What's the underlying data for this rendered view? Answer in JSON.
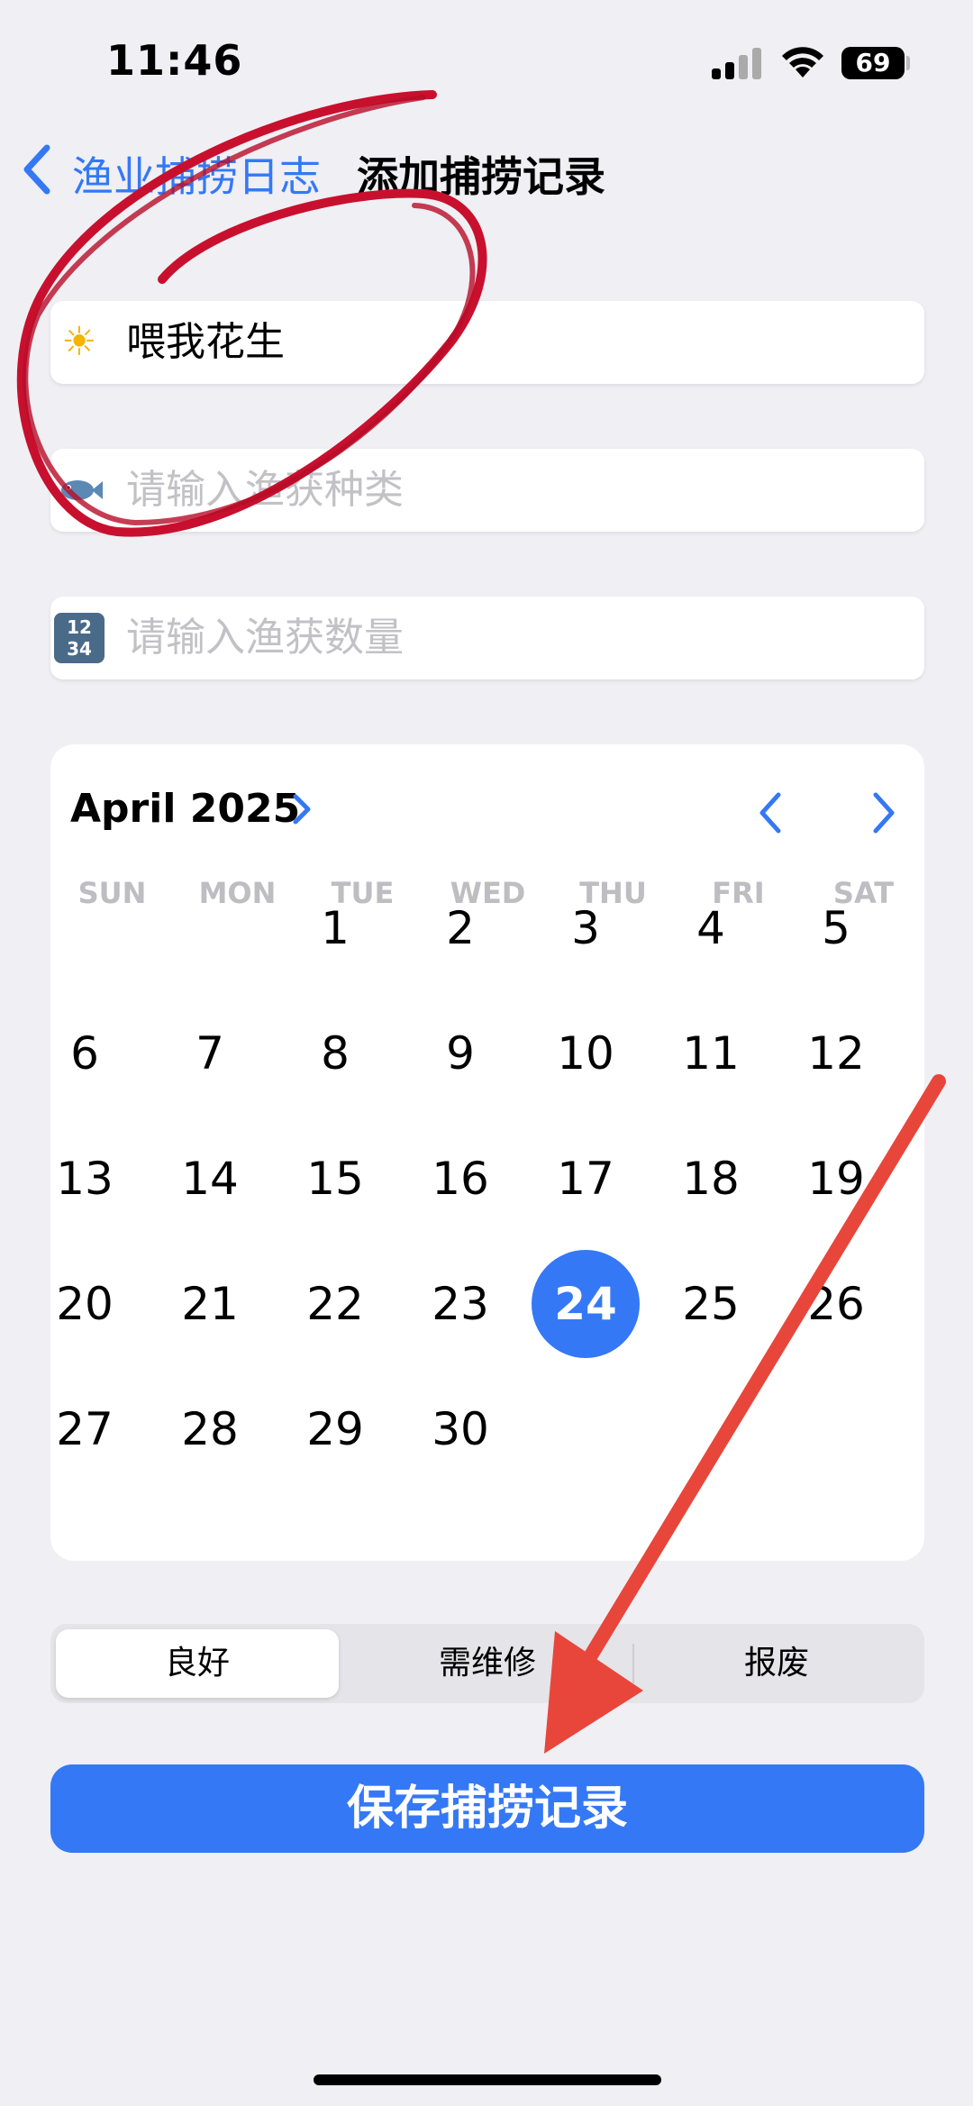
{
  "status_bar": {
    "time": "11:46",
    "battery": "69"
  },
  "nav": {
    "back_label": "渔业捕捞日志",
    "title": "添加捕捞记录"
  },
  "fields": [
    {
      "icon": "sun-icon",
      "glyph": "☀",
      "value": "喂我花生",
      "placeholder": ""
    },
    {
      "icon": "fish-icon",
      "glyph": "🐟",
      "value": "",
      "placeholder": "请输入渔获种类"
    },
    {
      "icon": "numbers-icon",
      "glyph": "12 34",
      "value": "",
      "placeholder": "请输入渔获数量"
    }
  ],
  "calendar": {
    "month_label": "April 2025",
    "weekdays": [
      "SUN",
      "MON",
      "TUE",
      "WED",
      "THU",
      "FRI",
      "SAT"
    ],
    "first_weekday_index": 2,
    "days_in_month": 30,
    "selected_day": "24"
  },
  "segmented": {
    "options": [
      "良好",
      "需维修",
      "报废"
    ],
    "selected_index": 0
  },
  "save_button": {
    "label": "保存捕捞记录"
  },
  "colors": {
    "accent": "#3478f6",
    "annotation_circle": "#c8102e",
    "annotation_arrow": "#e8463b"
  }
}
